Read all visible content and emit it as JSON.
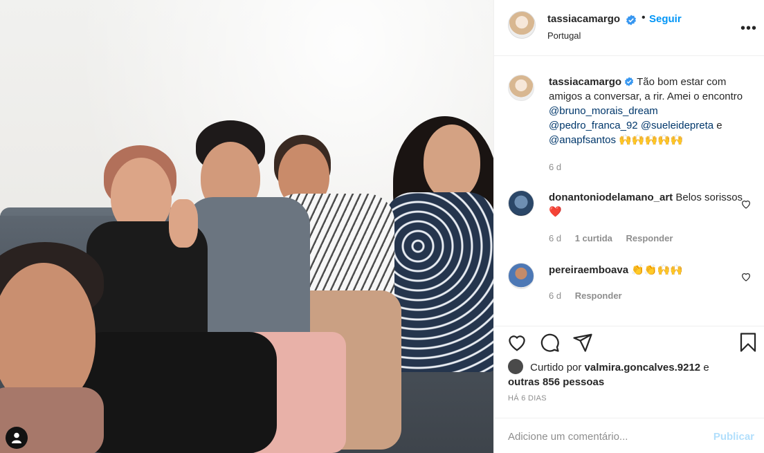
{
  "post": {
    "username": "tassiacamargo",
    "location": "Portugal",
    "follow_label": "Seguir",
    "dot": "•",
    "more_label": "•••"
  },
  "caption": {
    "username": "tassiacamargo",
    "text_1": "Tão bom estar com amigos a conversar, a rir. Amei o encontro",
    "mention_1": "@bruno_morais_dream",
    "mention_2": "@pedro_franca_92",
    "mention_3": "@sueleidepreta",
    "text_2": "e",
    "mention_4": "@anapfsantos",
    "emoji": "🙌🙌🙌🙌🙌",
    "time": "6 d"
  },
  "comments": [
    {
      "username": "donantoniodelamano_art",
      "text": "Belos sorissos",
      "emoji": "❤️",
      "time": "6 d",
      "likes": "1 curtida",
      "reply_label": "Responder"
    },
    {
      "username": "pereiraemboava",
      "text": "",
      "emoji": "👏👏🙌🙌",
      "time": "6 d",
      "reply_label": "Responder"
    }
  ],
  "likes": {
    "prefix": "Curtido por",
    "liker": "valmira.goncalves.9212",
    "conj": "e",
    "others": "outras 856 pessoas"
  },
  "posted_ago": "HÁ 6 DIAS",
  "add_comment": {
    "placeholder": "Adicione um comentário...",
    "publish_label": "Publicar"
  },
  "colors": {
    "accent": "#0095f6",
    "mention": "#00376b",
    "verified": "#3897f0",
    "muted": "#8e8e8e",
    "publish_disabled": "#b2dffc",
    "heart": "#ed4956"
  },
  "icons": [
    "verified-badge-icon",
    "more-options-icon",
    "heart-icon",
    "comment-icon",
    "share-icon",
    "bookmark-icon",
    "user-tag-icon"
  ]
}
